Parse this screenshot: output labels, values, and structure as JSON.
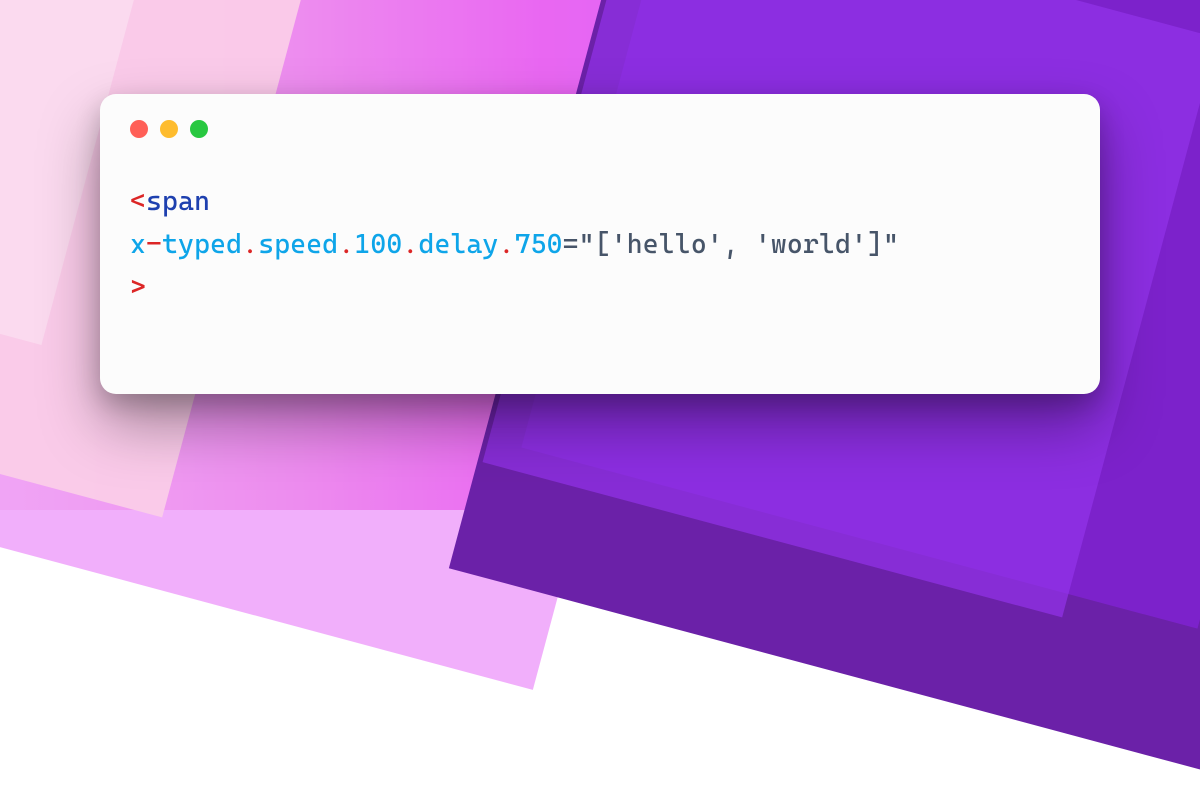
{
  "code": {
    "open_angle": "<",
    "close_angle": ">",
    "tag_name": "span",
    "attr_p1": "x",
    "attr_p2": "typed",
    "attr_p3": "speed",
    "attr_p4": "100",
    "attr_p5": "delay",
    "attr_p6": "750",
    "eq": "=",
    "dash": "-",
    "dot": ".",
    "value": "\"['hello', 'world']\""
  }
}
